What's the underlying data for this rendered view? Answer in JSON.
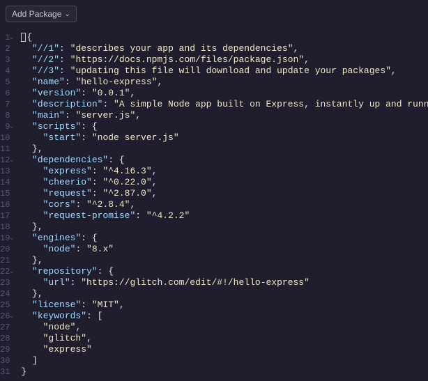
{
  "toolbar": {
    "add_package_label": "Add Package"
  },
  "editor": {
    "lines": [
      {
        "n": 1,
        "fold": true,
        "tokens": [
          [
            "cursor",
            ""
          ],
          [
            "bracket",
            "{"
          ]
        ]
      },
      {
        "n": 2,
        "fold": false,
        "tokens": [
          [
            "plain",
            "  "
          ],
          [
            "key",
            "\"//1\""
          ],
          [
            "punct",
            ": "
          ],
          [
            "string",
            "\"describes your app and its dependencies\""
          ],
          [
            "punct",
            ","
          ]
        ]
      },
      {
        "n": 3,
        "fold": false,
        "tokens": [
          [
            "plain",
            "  "
          ],
          [
            "key",
            "\"//2\""
          ],
          [
            "punct",
            ": "
          ],
          [
            "string",
            "\"https://docs.npmjs.com/files/package.json\""
          ],
          [
            "punct",
            ","
          ]
        ]
      },
      {
        "n": 4,
        "fold": false,
        "tokens": [
          [
            "plain",
            "  "
          ],
          [
            "key",
            "\"//3\""
          ],
          [
            "punct",
            ": "
          ],
          [
            "string",
            "\"updating this file will download and update your packages\""
          ],
          [
            "punct",
            ","
          ]
        ]
      },
      {
        "n": 5,
        "fold": false,
        "tokens": [
          [
            "plain",
            "  "
          ],
          [
            "key",
            "\"name\""
          ],
          [
            "punct",
            ": "
          ],
          [
            "string",
            "\"hello-express\""
          ],
          [
            "punct",
            ","
          ]
        ]
      },
      {
        "n": 6,
        "fold": false,
        "tokens": [
          [
            "plain",
            "  "
          ],
          [
            "key",
            "\"version\""
          ],
          [
            "punct",
            ": "
          ],
          [
            "string",
            "\"0.0.1\""
          ],
          [
            "punct",
            ","
          ]
        ]
      },
      {
        "n": 7,
        "fold": false,
        "tokens": [
          [
            "plain",
            "  "
          ],
          [
            "key",
            "\"description\""
          ],
          [
            "punct",
            ": "
          ],
          [
            "string",
            "\"A simple Node app built on Express, instantly up and running.\""
          ],
          [
            "punct",
            ","
          ]
        ]
      },
      {
        "n": 8,
        "fold": false,
        "tokens": [
          [
            "plain",
            "  "
          ],
          [
            "key",
            "\"main\""
          ],
          [
            "punct",
            ": "
          ],
          [
            "string",
            "\"server.js\""
          ],
          [
            "punct",
            ","
          ]
        ]
      },
      {
        "n": 9,
        "fold": true,
        "tokens": [
          [
            "plain",
            "  "
          ],
          [
            "key",
            "\"scripts\""
          ],
          [
            "punct",
            ": "
          ],
          [
            "bracket",
            "{"
          ]
        ]
      },
      {
        "n": 10,
        "fold": false,
        "tokens": [
          [
            "plain",
            "    "
          ],
          [
            "key",
            "\"start\""
          ],
          [
            "punct",
            ": "
          ],
          [
            "string",
            "\"node server.js\""
          ]
        ]
      },
      {
        "n": 11,
        "fold": false,
        "tokens": [
          [
            "plain",
            "  "
          ],
          [
            "bracket",
            "}"
          ],
          [
            "punct",
            ","
          ]
        ]
      },
      {
        "n": 12,
        "fold": true,
        "tokens": [
          [
            "plain",
            "  "
          ],
          [
            "key",
            "\"dependencies\""
          ],
          [
            "punct",
            ": "
          ],
          [
            "bracket",
            "{"
          ]
        ]
      },
      {
        "n": 13,
        "fold": false,
        "tokens": [
          [
            "plain",
            "    "
          ],
          [
            "key",
            "\"express\""
          ],
          [
            "punct",
            ": "
          ],
          [
            "string",
            "\"^4.16.3\""
          ],
          [
            "punct",
            ","
          ]
        ]
      },
      {
        "n": 14,
        "fold": false,
        "tokens": [
          [
            "plain",
            "    "
          ],
          [
            "key",
            "\"cheerio\""
          ],
          [
            "punct",
            ": "
          ],
          [
            "string",
            "\"^0.22.0\""
          ],
          [
            "punct",
            ","
          ]
        ]
      },
      {
        "n": 15,
        "fold": false,
        "tokens": [
          [
            "plain",
            "    "
          ],
          [
            "key",
            "\"request\""
          ],
          [
            "punct",
            ": "
          ],
          [
            "string",
            "\"^2.87.0\""
          ],
          [
            "punct",
            ","
          ]
        ]
      },
      {
        "n": 16,
        "fold": false,
        "tokens": [
          [
            "plain",
            "    "
          ],
          [
            "key",
            "\"cors\""
          ],
          [
            "punct",
            ": "
          ],
          [
            "string",
            "\"^2.8.4\""
          ],
          [
            "punct",
            ","
          ]
        ]
      },
      {
        "n": 17,
        "fold": false,
        "tokens": [
          [
            "plain",
            "    "
          ],
          [
            "key",
            "\"request-promise\""
          ],
          [
            "punct",
            ": "
          ],
          [
            "string",
            "\"^4.2.2\""
          ]
        ]
      },
      {
        "n": 18,
        "fold": false,
        "tokens": [
          [
            "plain",
            "  "
          ],
          [
            "bracket",
            "}"
          ],
          [
            "punct",
            ","
          ]
        ]
      },
      {
        "n": 19,
        "fold": true,
        "tokens": [
          [
            "plain",
            "  "
          ],
          [
            "key",
            "\"engines\""
          ],
          [
            "punct",
            ": "
          ],
          [
            "bracket",
            "{"
          ]
        ]
      },
      {
        "n": 20,
        "fold": false,
        "tokens": [
          [
            "plain",
            "    "
          ],
          [
            "key",
            "\"node\""
          ],
          [
            "punct",
            ": "
          ],
          [
            "string",
            "\"8.x\""
          ]
        ]
      },
      {
        "n": 21,
        "fold": false,
        "tokens": [
          [
            "plain",
            "  "
          ],
          [
            "bracket",
            "}"
          ],
          [
            "punct",
            ","
          ]
        ]
      },
      {
        "n": 22,
        "fold": true,
        "tokens": [
          [
            "plain",
            "  "
          ],
          [
            "key",
            "\"repository\""
          ],
          [
            "punct",
            ": "
          ],
          [
            "bracket",
            "{"
          ]
        ]
      },
      {
        "n": 23,
        "fold": false,
        "tokens": [
          [
            "plain",
            "    "
          ],
          [
            "key",
            "\"url\""
          ],
          [
            "punct",
            ": "
          ],
          [
            "string",
            "\"https://glitch.com/edit/#!/hello-express\""
          ]
        ]
      },
      {
        "n": 24,
        "fold": false,
        "tokens": [
          [
            "plain",
            "  "
          ],
          [
            "bracket",
            "}"
          ],
          [
            "punct",
            ","
          ]
        ]
      },
      {
        "n": 25,
        "fold": false,
        "tokens": [
          [
            "plain",
            "  "
          ],
          [
            "key",
            "\"license\""
          ],
          [
            "punct",
            ": "
          ],
          [
            "string",
            "\"MIT\""
          ],
          [
            "punct",
            ","
          ]
        ]
      },
      {
        "n": 26,
        "fold": true,
        "tokens": [
          [
            "plain",
            "  "
          ],
          [
            "key",
            "\"keywords\""
          ],
          [
            "punct",
            ": "
          ],
          [
            "bracket",
            "["
          ]
        ]
      },
      {
        "n": 27,
        "fold": false,
        "tokens": [
          [
            "plain",
            "    "
          ],
          [
            "string",
            "\"node\""
          ],
          [
            "punct",
            ","
          ]
        ]
      },
      {
        "n": 28,
        "fold": false,
        "tokens": [
          [
            "plain",
            "    "
          ],
          [
            "string",
            "\"glitch\""
          ],
          [
            "punct",
            ","
          ]
        ]
      },
      {
        "n": 29,
        "fold": false,
        "tokens": [
          [
            "plain",
            "    "
          ],
          [
            "string",
            "\"express\""
          ]
        ]
      },
      {
        "n": 30,
        "fold": false,
        "tokens": [
          [
            "plain",
            "  "
          ],
          [
            "bracket",
            "]"
          ]
        ]
      },
      {
        "n": 31,
        "fold": false,
        "tokens": [
          [
            "bracket",
            "}"
          ]
        ]
      }
    ]
  }
}
